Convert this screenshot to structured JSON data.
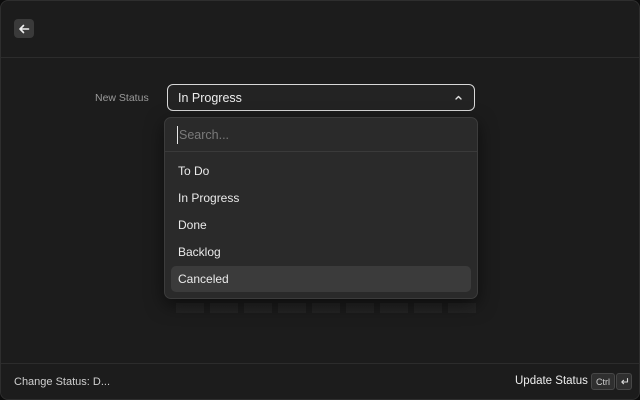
{
  "form": {
    "label": "New Status",
    "selected": "In Progress"
  },
  "dropdown": {
    "search_placeholder": "Search...",
    "search_value": "",
    "options": [
      "To Do",
      "In Progress",
      "Done",
      "Backlog",
      "Canceled"
    ],
    "highlighted": "Canceled"
  },
  "footer": {
    "title": "Change Status: D...",
    "action_label": "Update Status",
    "shortcut_key_1": "Ctrl",
    "shortcut_key_2_icon": "enter-icon"
  },
  "icons": {
    "back": "arrow-left-icon",
    "chevron": "chevron-up-icon"
  },
  "colors": {
    "background": "#1c1c1c",
    "dropdown": "#2a2a2a",
    "highlight": "#3b3b3b",
    "select_border": "#d8d8d8"
  }
}
